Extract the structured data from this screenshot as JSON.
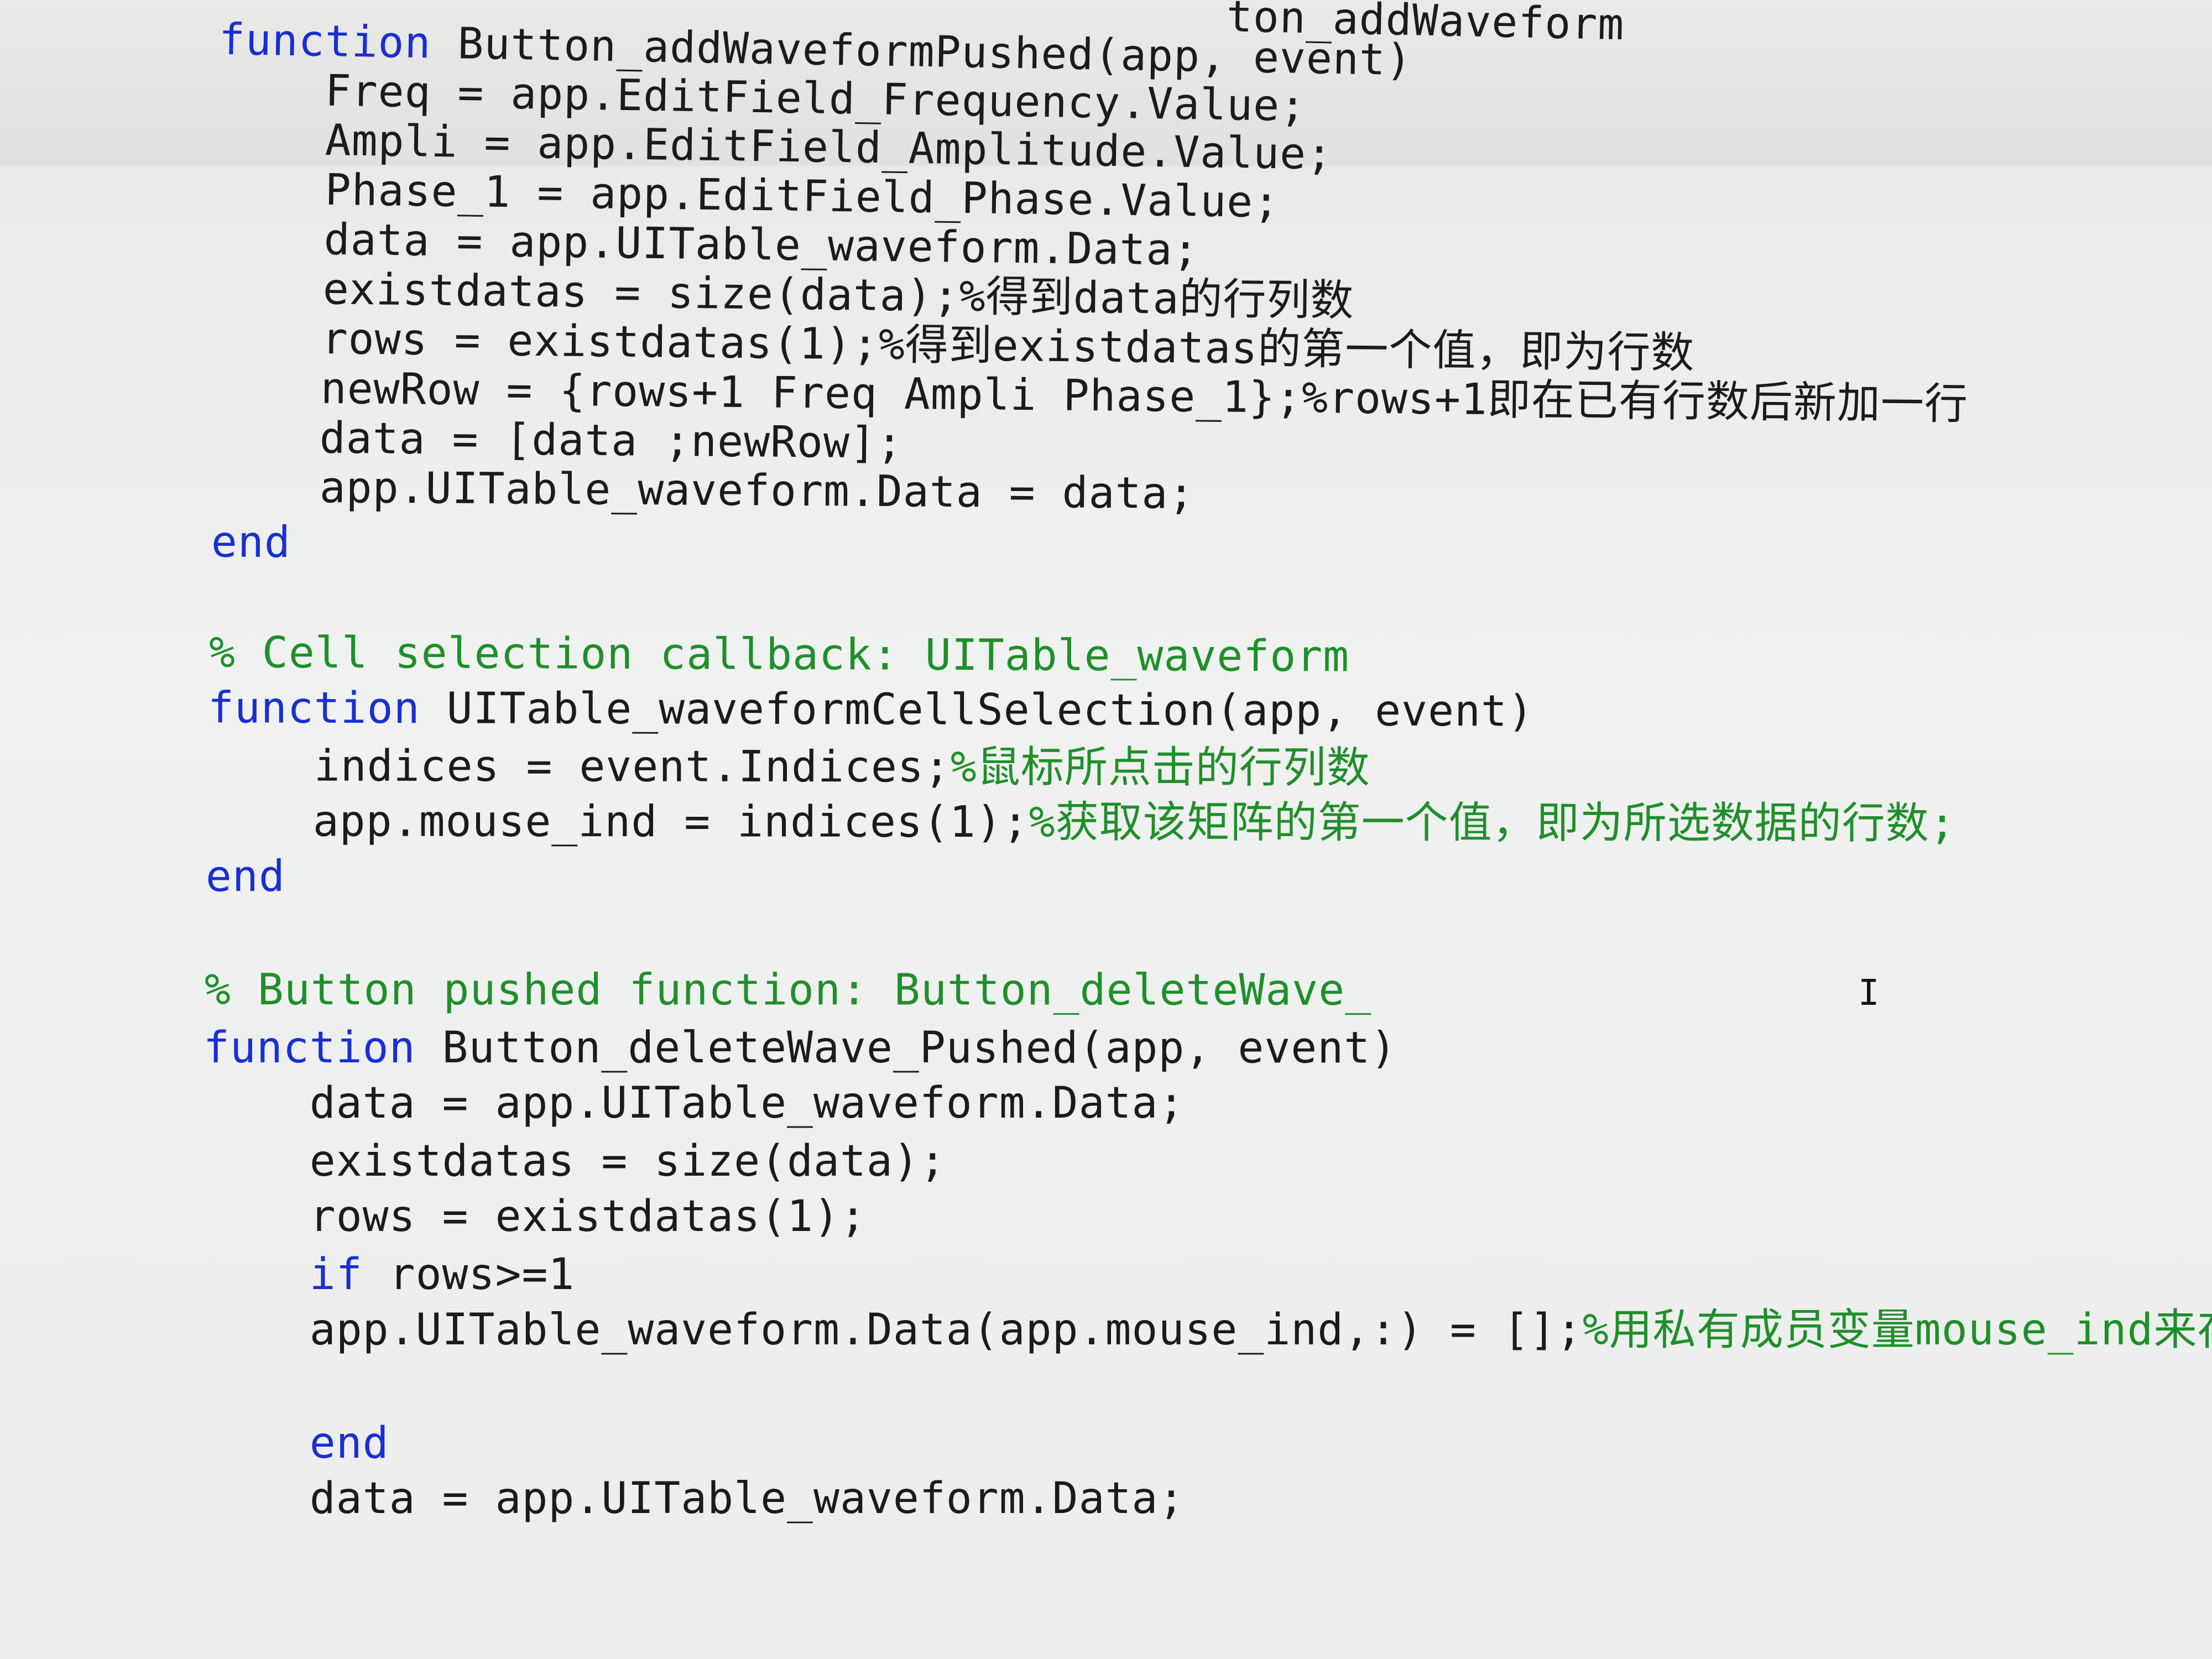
{
  "editor": {
    "lines": [
      {
        "tokens": [
          {
            "t": "tx",
            "v": "                                        ton_addWaveform"
          }
        ]
      },
      {
        "tokens": [
          {
            "t": "kw",
            "v": "  function "
          },
          {
            "t": "tx",
            "v": "Button_addWaveformPushed(app, event)"
          }
        ]
      },
      {
        "tokens": [
          {
            "t": "tx",
            "v": "      Freq = app.EditField_Frequency.Value;"
          }
        ]
      },
      {
        "tokens": [
          {
            "t": "tx",
            "v": "      Ampli = app.EditField_Amplitude.Value;"
          }
        ]
      },
      {
        "tokens": [
          {
            "t": "tx",
            "v": "      Phase_1 = app.EditField_Phase.Value;"
          }
        ]
      },
      {
        "tokens": [
          {
            "t": "tx",
            "v": "      data = app.UITable_waveform.Data;"
          }
        ]
      },
      {
        "tokens": [
          {
            "t": "tx",
            "v": "      existdatas = size(data);%得到data的行列数"
          }
        ]
      },
      {
        "tokens": [
          {
            "t": "tx",
            "v": "      rows = existdatas(1);%得到existdatas的第一个值，即为行数"
          }
        ]
      },
      {
        "tokens": [
          {
            "t": "tx",
            "v": "      newRow = {rows+1 Freq Ampli Phase_1};%rows+1即在已有行数后新加一行"
          }
        ]
      },
      {
        "tokens": [
          {
            "t": "tx",
            "v": "      data = [data ;newRow];"
          }
        ]
      },
      {
        "tokens": [
          {
            "t": "tx",
            "v": "      app.UITable_waveform.Data = data;"
          }
        ]
      },
      {
        "tokens": [
          {
            "t": "kw",
            "v": "  end"
          }
        ]
      },
      {
        "tokens": [
          {
            "t": "tx",
            "v": ""
          }
        ]
      },
      {
        "tokens": [
          {
            "t": "cm",
            "v": "  % Cell selection callback: UITable_waveform"
          }
        ]
      },
      {
        "tokens": [
          {
            "t": "kw",
            "v": "  function "
          },
          {
            "t": "tx",
            "v": "UITable_waveformCellSelection(app, event)"
          }
        ]
      },
      {
        "tokens": [
          {
            "t": "tx",
            "v": "      indices = event.Indices;"
          },
          {
            "t": "cm",
            "v": "%鼠标所点击的行列数"
          }
        ]
      },
      {
        "tokens": [
          {
            "t": "tx",
            "v": "      app.mouse_ind = indices(1);"
          },
          {
            "t": "cm",
            "v": "%获取该矩阵的第一个值，即为所选数据的行数;"
          }
        ]
      },
      {
        "tokens": [
          {
            "t": "kw",
            "v": "  end"
          }
        ]
      },
      {
        "tokens": [
          {
            "t": "tx",
            "v": ""
          }
        ]
      },
      {
        "tokens": [
          {
            "t": "cm",
            "v": "  % Button pushed function: Button_deleteWave_"
          }
        ]
      },
      {
        "tokens": [
          {
            "t": "kw",
            "v": "  function "
          },
          {
            "t": "tx",
            "v": "Button_deleteWave_Pushed(app, event)"
          }
        ]
      },
      {
        "tokens": [
          {
            "t": "tx",
            "v": "      data = app.UITable_waveform.Data;"
          }
        ]
      },
      {
        "tokens": [
          {
            "t": "tx",
            "v": "      existdatas = size(data);"
          }
        ]
      },
      {
        "tokens": [
          {
            "t": "tx",
            "v": "      rows = existdatas(1);"
          }
        ]
      },
      {
        "tokens": [
          {
            "t": "kw",
            "v": "      if "
          },
          {
            "t": "tx",
            "v": "rows>=1"
          }
        ]
      },
      {
        "tokens": [
          {
            "t": "tx",
            "v": "      app.UITable_waveform.Data(app.mouse_ind,:) = [];"
          },
          {
            "t": "cm",
            "v": "%用私有成员变量mouse_ind来存鼠标在"
          }
        ]
      },
      {
        "tokens": [
          {
            "t": "tx",
            "v": ""
          }
        ]
      },
      {
        "tokens": [
          {
            "t": "kw",
            "v": "      end"
          }
        ]
      },
      {
        "tokens": [
          {
            "t": "tx",
            "v": "      data = app.UITable_waveform.Data;"
          }
        ]
      }
    ]
  },
  "cursor": {
    "glyph": "I"
  }
}
